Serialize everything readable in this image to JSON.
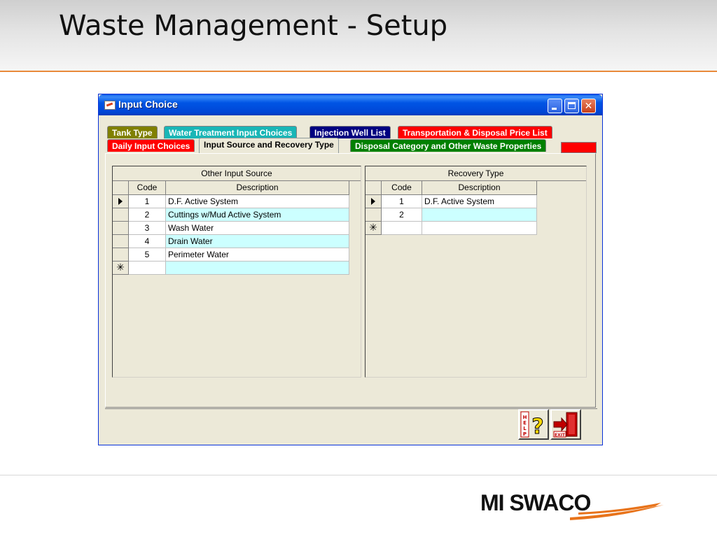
{
  "slide": {
    "title": "Waste Management - Setup"
  },
  "window": {
    "title": "Input Choice",
    "buttons": {
      "minimize": "_",
      "maximize": "□",
      "close": "✕"
    }
  },
  "tabs": {
    "row1": [
      "Tank Type",
      "Water Treatment Input Choices",
      "Injection Well List",
      "Transportation & Disposal Price List"
    ],
    "row2": [
      "Daily Input Choices",
      "Input Source and Recovery Type",
      "Disposal Category and Other Waste Properties"
    ],
    "active": "Input Source and Recovery Type",
    "colors": {
      "olive": "#808000",
      "teal": "#19b6b6",
      "navy": "#000080",
      "red": "#ff0000",
      "green": "#008000"
    }
  },
  "other_input_source": {
    "caption": "Other Input Source",
    "columns": [
      "Code",
      "Description"
    ],
    "rows": [
      {
        "code": "1",
        "description": "D.F. Active System"
      },
      {
        "code": "2",
        "description": "Cuttings w/Mud Active System"
      },
      {
        "code": "3",
        "description": "Wash Water"
      },
      {
        "code": "4",
        "description": "Drain Water"
      },
      {
        "code": "5",
        "description": "Perimeter Water"
      }
    ],
    "new_row_marker": "✳"
  },
  "recovery_type": {
    "caption": "Recovery Type",
    "columns": [
      "Code",
      "Description"
    ],
    "rows": [
      {
        "code": "1",
        "description": "D.F. Active System"
      },
      {
        "code": "2",
        "description": ""
      }
    ],
    "new_row_marker": "✳"
  },
  "buttons": {
    "help_icon": "help-icon",
    "exit_icon": "exit-icon"
  },
  "logo": {
    "text": "MI SWACO",
    "accent": "#e8731a"
  }
}
